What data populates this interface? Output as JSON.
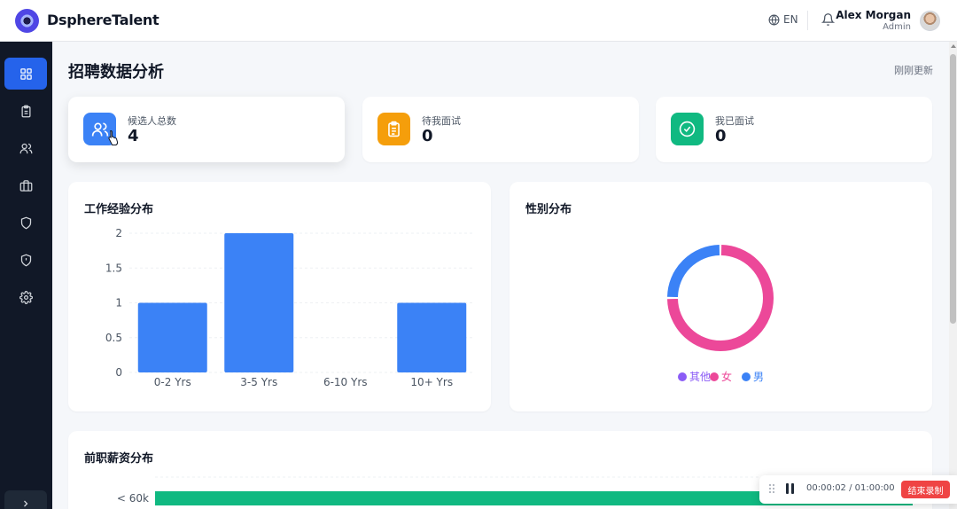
{
  "app": {
    "brand": "DsphereTalent"
  },
  "topbar": {
    "language": "EN",
    "user": {
      "name": "Alex Morgan",
      "role": "Admin"
    }
  },
  "sidebar": {
    "items": [
      {
        "icon": "dashboard-icon",
        "active": true
      },
      {
        "icon": "clipboard-icon",
        "active": false
      },
      {
        "icon": "users-icon",
        "active": false
      },
      {
        "icon": "briefcase-icon",
        "active": false
      },
      {
        "icon": "shield-icon",
        "active": false
      },
      {
        "icon": "shield-alert-icon",
        "active": false
      },
      {
        "icon": "gear-icon",
        "active": false
      }
    ]
  },
  "page": {
    "title": "招聘数据分析",
    "refresh": "刚刚更新"
  },
  "stats": [
    {
      "label": "候选人总数",
      "value": "4",
      "icon": "users-icon",
      "color": "#3b82f6"
    },
    {
      "label": "待我面试",
      "value": "0",
      "icon": "clipboard-icon",
      "color": "#f59e0b"
    },
    {
      "label": "我已面试",
      "value": "0",
      "icon": "check-circle-icon",
      "color": "#10b981"
    }
  ],
  "experience": {
    "title": "工作经验分布"
  },
  "gender": {
    "title": "性别分布"
  },
  "salary": {
    "title": "前职薪资分布"
  },
  "recording": {
    "time": "00:00:02 / 01:00:00",
    "stop_label": "结束录制"
  },
  "chart_data": [
    {
      "type": "bar",
      "title": "工作经验分布",
      "categories": [
        "0-2 Yrs",
        "3-5 Yrs",
        "6-10 Yrs",
        "10+ Yrs"
      ],
      "values": [
        1,
        2,
        0,
        1
      ],
      "ylim": [
        0,
        2
      ],
      "yticks": [
        "0",
        "0.5",
        "1",
        "1.5",
        "2"
      ],
      "grid": true,
      "color": "#3b82f6"
    },
    {
      "type": "pie",
      "title": "性别分布",
      "labels": [
        "其他",
        "女",
        "男"
      ],
      "values": [
        0,
        3,
        1
      ],
      "colors": [
        "#8b5cf6",
        "#ec4899",
        "#3b82f6"
      ],
      "legend": "bottom"
    },
    {
      "type": "bar",
      "title": "前职薪资分布",
      "orientation": "horizontal",
      "categories": [
        "< 60k"
      ],
      "color": "#10b981"
    }
  ]
}
